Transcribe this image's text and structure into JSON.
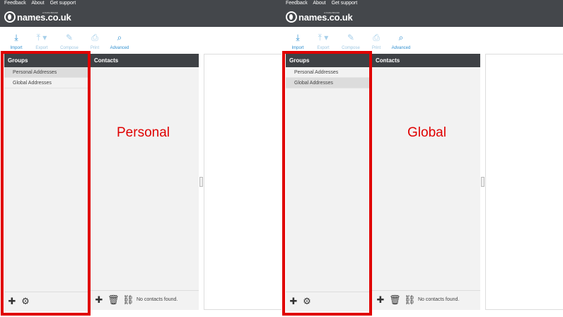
{
  "colors": {
    "topbar": "#44474b",
    "panel_header": "#3e4145",
    "panel_bg": "#f2f2f2",
    "accent": "#2f8fd0",
    "highlight": "#e00000"
  },
  "panels": [
    {
      "toplinks": {
        "feedback": "Feedback",
        "about": "About",
        "support": "Get support"
      },
      "logo": {
        "text": "names.co.uk",
        "tagline": "A DADA BRAND"
      },
      "toolbar": {
        "import": "Import",
        "export": "Export",
        "compose": "Compose",
        "print": "Print",
        "advanced": "Advanced"
      },
      "groups": {
        "header": "Groups",
        "items": [
          "Personal Addresses",
          "Global Addresses"
        ],
        "selected": "Personal Addresses"
      },
      "contacts": {
        "header": "Contacts",
        "empty": "No contacts found."
      },
      "annotation": "Personal"
    },
    {
      "toplinks": {
        "feedback": "Feedback",
        "about": "About",
        "support": "Get support"
      },
      "logo": {
        "text": "names.co.uk",
        "tagline": "A DADA BRAND"
      },
      "toolbar": {
        "import": "Import",
        "export": "Export",
        "compose": "Compose",
        "print": "Print",
        "advanced": "Advanced"
      },
      "groups": {
        "header": "Groups",
        "items": [
          "Personal Addresses",
          "Global Addresses"
        ],
        "selected": "Global Addresses"
      },
      "contacts": {
        "header": "Contacts",
        "empty": "No contacts found."
      },
      "annotation": "Global"
    }
  ]
}
